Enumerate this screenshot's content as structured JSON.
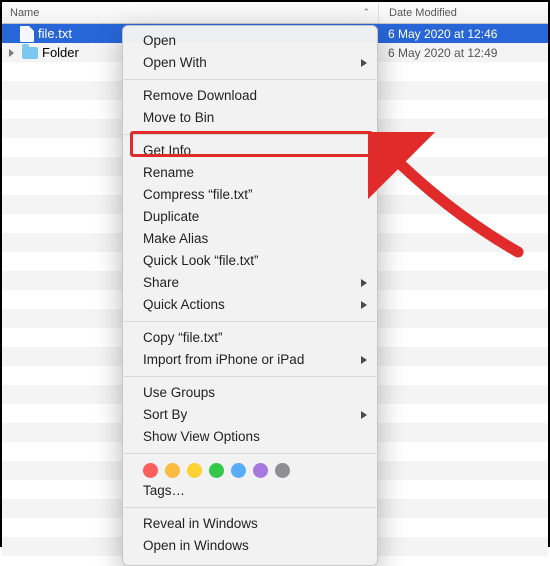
{
  "header": {
    "name": "Name",
    "date": "Date Modified"
  },
  "rows": [
    {
      "name": "file.txt",
      "date": "6 May 2020 at 12:46",
      "type": "file",
      "selected": true
    },
    {
      "name": "Folder",
      "date": "6 May 2020 at 12:49",
      "type": "folder",
      "selected": false
    }
  ],
  "menu": {
    "open": "Open",
    "open_with": "Open With",
    "remove_download": "Remove Download",
    "move_to_bin": "Move to Bin",
    "get_info": "Get Info",
    "rename": "Rename",
    "compress": "Compress “file.txt”",
    "duplicate": "Duplicate",
    "make_alias": "Make Alias",
    "quick_look": "Quick Look “file.txt”",
    "share": "Share",
    "quick_actions": "Quick Actions",
    "copy": "Copy “file.txt”",
    "import_ios": "Import from iPhone or iPad",
    "use_groups": "Use Groups",
    "sort_by": "Sort By",
    "show_view_options": "Show View Options",
    "tags_label": "Tags…",
    "reveal": "Reveal in Windows",
    "open_in": "Open in Windows"
  },
  "tag_colors": [
    "#fc605c",
    "#fdbc40",
    "#fdd231",
    "#34c84a",
    "#57acf5",
    "#a679e0",
    "#8e8e93"
  ]
}
